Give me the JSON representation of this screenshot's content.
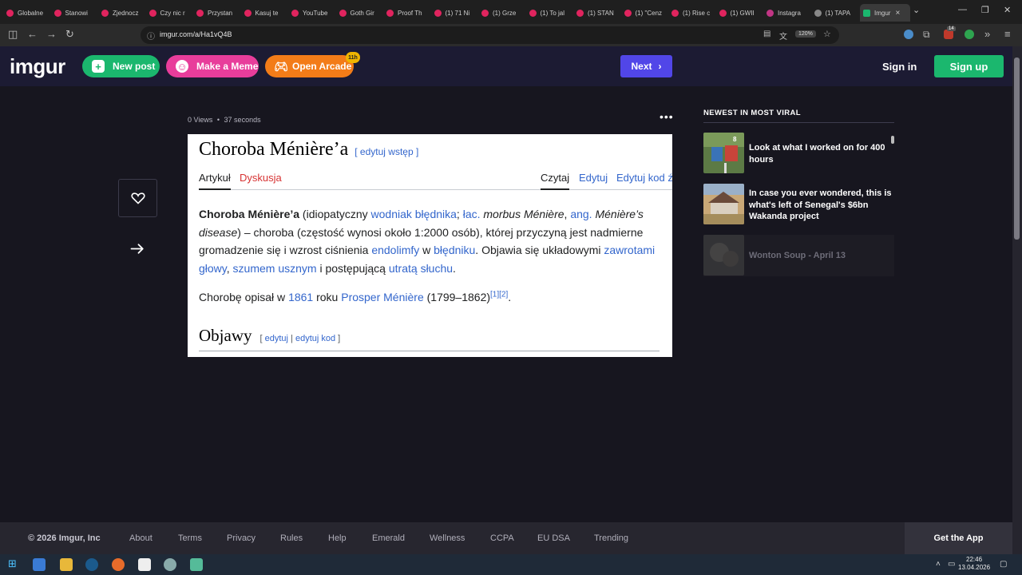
{
  "browser": {
    "tabs": [
      {
        "label": "Globalne",
        "color": "#e0245e"
      },
      {
        "label": "Stanowi",
        "color": "#e0245e"
      },
      {
        "label": "Zjednocz",
        "color": "#e0245e"
      },
      {
        "label": "Czy nic r",
        "color": "#e0245e"
      },
      {
        "label": "Przystan",
        "color": "#e0245e"
      },
      {
        "label": "Kasuj te",
        "color": "#e0245e"
      },
      {
        "label": "YouTube",
        "color": "#e0245e"
      },
      {
        "label": "Goth Gir",
        "color": "#e0245e"
      },
      {
        "label": "Proof Th",
        "color": "#e0245e"
      },
      {
        "label": "(1) 71 Ni",
        "color": "#e0245e"
      },
      {
        "label": "(1) Grze",
        "color": "#e0245e"
      },
      {
        "label": "(1) To jal",
        "color": "#e0245e"
      },
      {
        "label": "(1) STAN",
        "color": "#e0245e"
      },
      {
        "label": "(1) \"Cenz",
        "color": "#e0245e"
      },
      {
        "label": "(1) Rise c",
        "color": "#e0245e"
      },
      {
        "label": "(1) GWII",
        "color": "#e0245e"
      },
      {
        "label": "Instagra",
        "color": "#c13584"
      },
      {
        "label": "(1) TAPA",
        "color": "#888888"
      }
    ],
    "active_tab": "Imgur",
    "url": "imgur.com/a/Ha1vQ4B",
    "zoom": "120%",
    "ext_badge": "14"
  },
  "header": {
    "logo": "imgur",
    "new_post": "New post",
    "make_meme": "Make a Meme",
    "open_arcade": "Open Arcade",
    "arcade_badge": "11h",
    "next": "Next",
    "sign_in": "Sign in",
    "sign_up": "Sign up"
  },
  "post": {
    "views": "0 Views",
    "sep": "•",
    "time": "37 seconds",
    "more": "•••",
    "wiki": {
      "title": "Choroba Ménière’a",
      "edit_intro": "[ edytuj wstęp ]",
      "tabs_left": [
        "Artykuł",
        "Dyskusja"
      ],
      "tabs_right": [
        "Czytaj",
        "Edytuj",
        "Edytuj kod źr"
      ],
      "p1": {
        "bold": "Choroba Ménière’a",
        "t1": " (idiopatyczny ",
        "l1": "wodniak błędnika",
        "t2": "; ",
        "l2": "łac.",
        "i1": " morbus Ménière",
        "t3": ", ",
        "l3": "ang.",
        "i2": " Ménière’s disease",
        "t4": ") – choroba (częstość wynosi około 1:2000 osób), której przyczyną jest nadmierne gromadzenie się i wzrost ciśnienia ",
        "l4": "endolimfy",
        "t5": " w ",
        "l5": "błędniku",
        "t6": ". Objawia się układowymi ",
        "l6": "zawrotami głowy",
        "t7": ", ",
        "l7": "szumem usznym",
        "t8": " i postępującą ",
        "l8": "utratą słuchu",
        "t9": "."
      },
      "p2": {
        "t1": "Chorobę opisał w ",
        "l1": "1861",
        "t2": " roku ",
        "l2": "Prosper Ménière",
        "t3": " (1799–1862)",
        "sup": "[1][2]",
        "t4": "."
      },
      "h2": "Objawy",
      "h2_edit_open": "[ ",
      "h2_edit1": "edytuj",
      "h2_sep": " | ",
      "h2_edit2": "edytuj kod",
      "h2_edit_close": " ]"
    }
  },
  "sidebar": {
    "title": "NEWEST IN MOST VIRAL",
    "items": [
      {
        "text": "Look at what I worked on for 400 hours",
        "count": "8"
      },
      {
        "text": "In case you ever wondered, this is what's left of Senegal's $6bn Wakanda project"
      },
      {
        "text": "Wonton Soup - April 13"
      }
    ]
  },
  "footer": {
    "copyright": "© 2026 Imgur, Inc",
    "links": [
      "About",
      "Terms",
      "Privacy",
      "Rules",
      "Help",
      "Emerald",
      "Wellness",
      "CCPA",
      "EU DSA",
      "Trending"
    ],
    "get_app": "Get the App"
  },
  "taskbar": {
    "time": "22:46",
    "date": "13.04.2026"
  },
  "colors": {
    "page_bg": "#17161f",
    "header_bg": "#1c1b33",
    "new_post": "#1bb76e",
    "make_meme": "#e83d9b",
    "open_arcade": "#f37c18",
    "next": "#5146e8",
    "sign_up": "#1bb76e",
    "wiki_link": "#3366cc",
    "wiki_red_link": "#d73333"
  }
}
